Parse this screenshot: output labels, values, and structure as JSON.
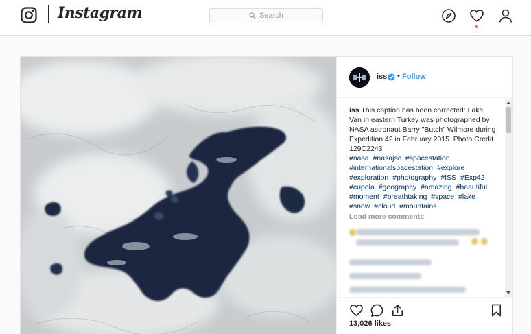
{
  "nav": {
    "wordmark": "Instagram",
    "search_placeholder": "Search",
    "icons": [
      "instagram-glyph-icon",
      "compass-icon",
      "heart-icon",
      "profile-icon",
      "search-icon"
    ],
    "notification_dot_color": "#ed4956"
  },
  "post": {
    "username": "iss",
    "verified": true,
    "separator": "•",
    "follow_label": "Follow",
    "caption_user": "iss",
    "caption_text": "This caption has been corrected: Lake Van in eastern Turkey was photographed by NASA astronaut Barry \"Butch\" Wilmore during Expedition 42 in February 2015. Photo Credit 129C2243",
    "hashtags": [
      "#nasa",
      "#nasajsc",
      "#spacestation",
      "#internationalspacestation",
      "#explore",
      "#exploration",
      "#photography",
      "#ISS",
      "#Exp42",
      "#cupola",
      "#geography",
      "#amazing",
      "#beautiful",
      "#moment",
      "#breathtaking",
      "#space",
      "#lake",
      "#snow",
      "#cloud",
      "#mountains"
    ],
    "load_more_label": "Load more comments",
    "likes_text": "13,026 likes",
    "action_icons": [
      "heart-icon",
      "comment-icon",
      "share-icon",
      "bookmark-icon"
    ]
  },
  "colors": {
    "link": "#3897f0",
    "hashtag": "#003569",
    "muted": "#999999",
    "border": "#dbdbdb"
  }
}
